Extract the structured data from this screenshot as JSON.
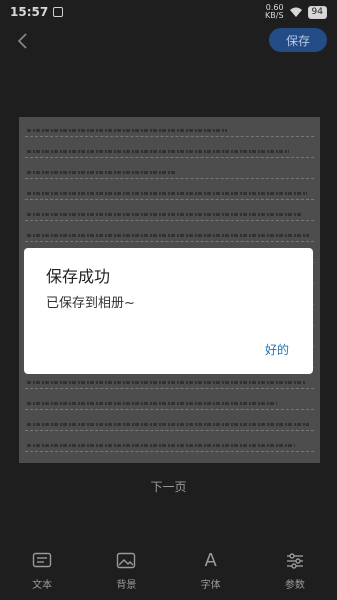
{
  "status_bar": {
    "time": "15:57",
    "net_speed_value": "0.60",
    "net_speed_unit": "KB/S",
    "battery": "94"
  },
  "top_nav": {
    "save_label": "保存"
  },
  "dialog": {
    "title": "保存成功",
    "message": "已保存到相册~",
    "ok_label": "好的"
  },
  "page_nav": {
    "next_label": "下一页"
  },
  "toolbar": {
    "items": [
      {
        "label": "文本",
        "icon": "text-icon"
      },
      {
        "label": "背景",
        "icon": "image-icon"
      },
      {
        "label": "字体",
        "icon": "font-icon"
      },
      {
        "label": "参数",
        "icon": "sliders-icon"
      }
    ]
  },
  "colors": {
    "accent": "#234c86",
    "dialog_button": "#1f74b6",
    "background": "#1e1e1e"
  }
}
